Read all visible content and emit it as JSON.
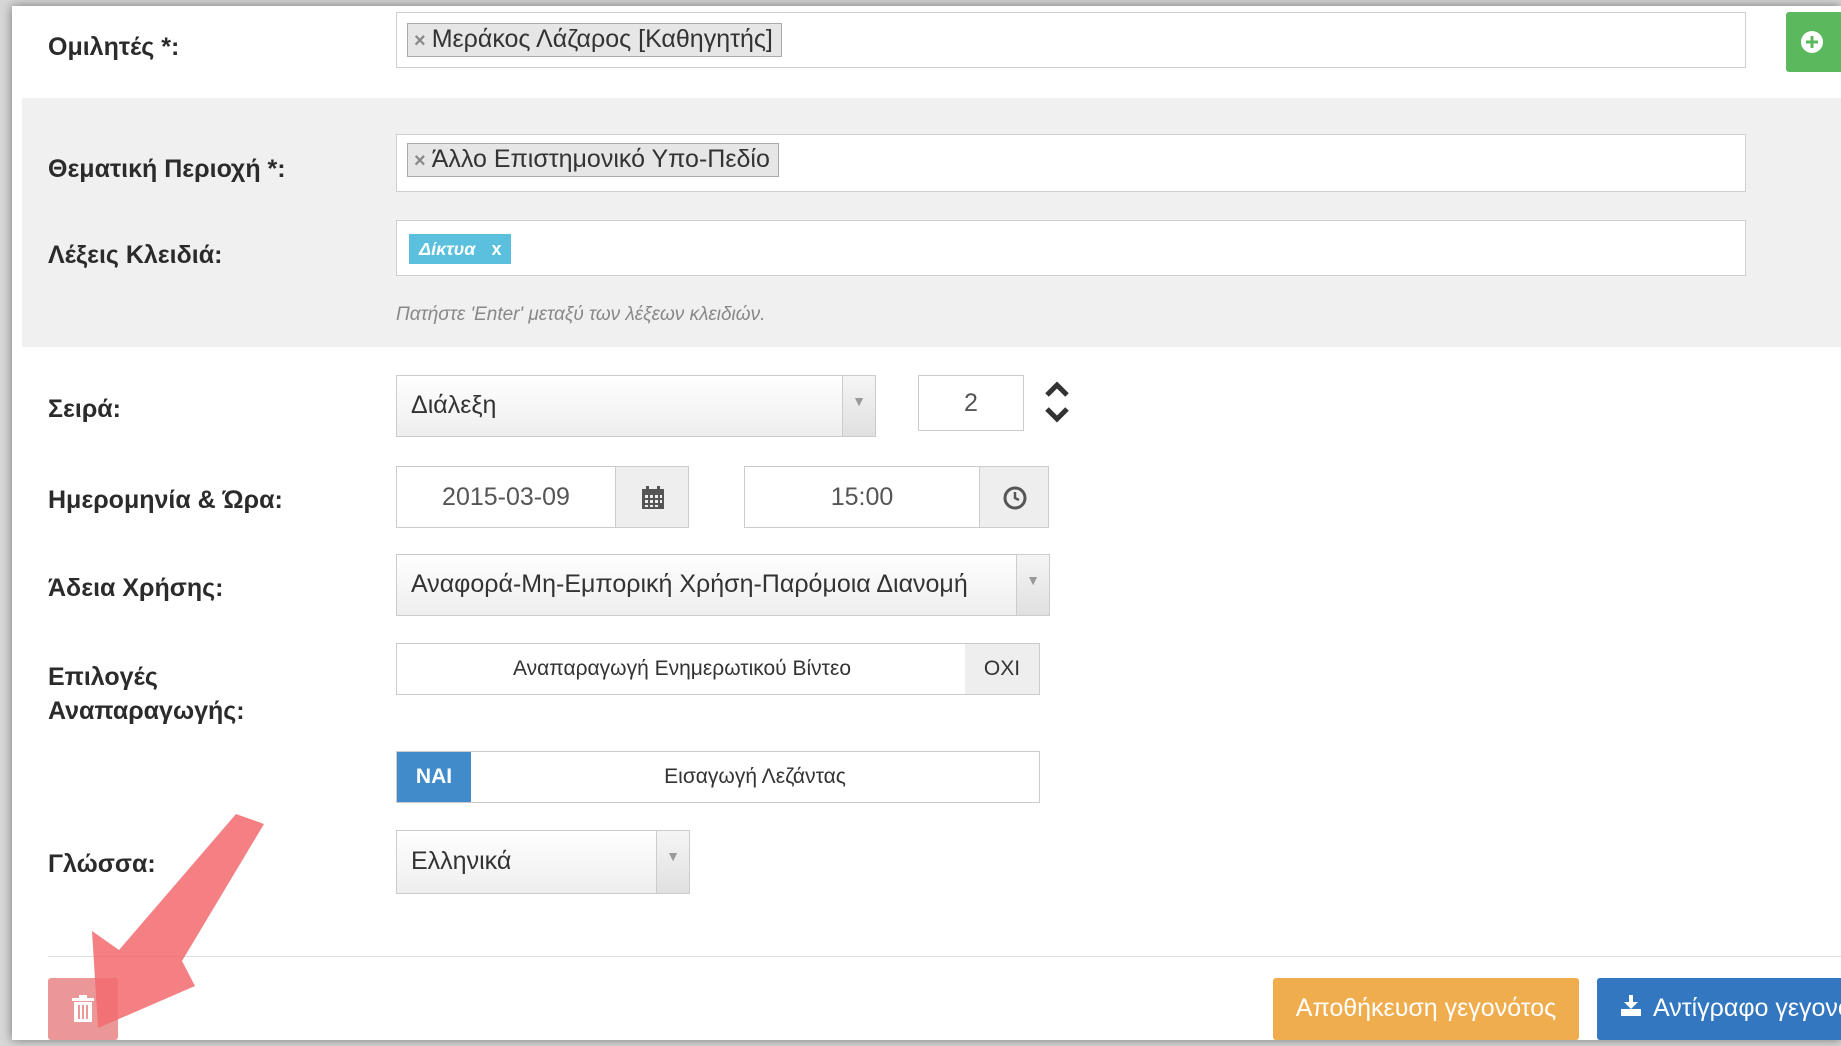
{
  "speakers": {
    "label": "Ομιλητές *:",
    "tag": "Μεράκος Λάζαρος [Καθηγητής]"
  },
  "thematic": {
    "label": "Θεματική Περιοχή *:",
    "tag": "Άλλο Επιστημονικό Υπο-Πεδίο"
  },
  "keywords": {
    "label": "Λέξεις Κλειδιά:",
    "tag": "Δίκτυα",
    "remove": "x",
    "help": "Πατήστε 'Enter' μεταξύ των λέξεων κλειδιών."
  },
  "series": {
    "label": "Σειρά:",
    "value": "Διάλεξη",
    "number": "2"
  },
  "datetime": {
    "label": "Ημερομηνία & Ώρα:",
    "date": "2015-03-09",
    "time": "15:00"
  },
  "license": {
    "label": "Άδεια Χρήσης:",
    "value": "Αναφορά-Μη-Εμπορική Χρήση-Παρόμοια Διανομή"
  },
  "playback": {
    "label_line1": "Επιλογές",
    "label_line2": "Αναπαραγωγής:",
    "toggle1_text": "Αναπαραγωγή Ενημερωτικού Βίντεο",
    "toggle1_state": "ΟΧΙ",
    "toggle2_state": "ΝΑΙ",
    "toggle2_text": "Εισαγωγή Λεζάντας"
  },
  "language": {
    "label": "Γλώσσα:",
    "value": "Ελληνικά"
  },
  "footer": {
    "save_label": "Αποθήκευση γεγονότος",
    "copy_label": "Αντίγραφο γεγονό"
  },
  "colors": {
    "add_green": "#5cb85c",
    "keyword_blue": "#5bc0de",
    "yes_blue": "#428bca",
    "save_orange": "#f0ad4e",
    "copy_blue": "#3277c0",
    "delete_red": "#ec9797",
    "arrow_red": "#f36a6e"
  }
}
